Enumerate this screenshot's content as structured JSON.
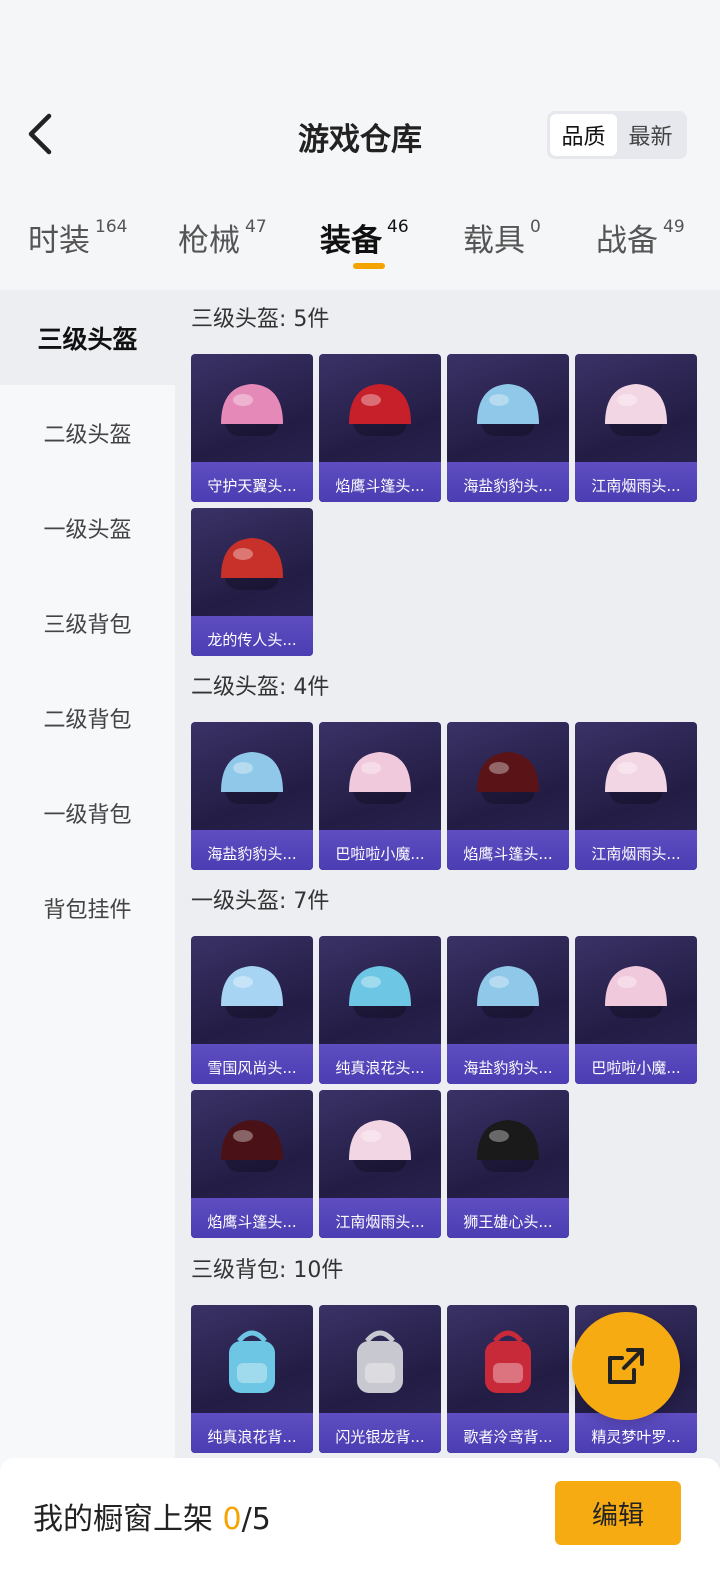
{
  "header": {
    "title": "游戏仓库",
    "sort_options": [
      "品质",
      "最新"
    ],
    "active_sort": "品质"
  },
  "tabs": [
    {
      "label": "时装",
      "count": "164"
    },
    {
      "label": "枪械",
      "count": "47"
    },
    {
      "label": "装备",
      "count": "46"
    },
    {
      "label": "载具",
      "count": "0"
    },
    {
      "label": "战备",
      "count": "49"
    }
  ],
  "active_tab": "装备",
  "sidebar": {
    "items": [
      "三级头盔",
      "二级头盔",
      "一级头盔",
      "三级背包",
      "二级背包",
      "一级背包",
      "背包挂件"
    ],
    "active": "三级头盔"
  },
  "sections": [
    {
      "title": "三级头盔: 5件",
      "items": [
        {
          "name": "守护天翼头...",
          "icon": "helmet-pink-icon",
          "color": "#e58ab8"
        },
        {
          "name": "焰鹰斗篷头...",
          "icon": "helmet-red-black-icon",
          "color": "#c8202a"
        },
        {
          "name": "海盐豹豹头...",
          "icon": "helmet-blue-icon",
          "color": "#8fc8e8"
        },
        {
          "name": "江南烟雨头...",
          "icon": "helmet-white-pink-icon",
          "color": "#f3d6e4"
        },
        {
          "name": "龙的传人头...",
          "icon": "helmet-red-gold-icon",
          "color": "#c8302a"
        }
      ]
    },
    {
      "title": "二级头盔: 4件",
      "items": [
        {
          "name": "海盐豹豹头...",
          "icon": "helmet-blue-icon",
          "color": "#8fc8e8"
        },
        {
          "name": "巴啦啦小魔...",
          "icon": "helmet-pink-bow-icon",
          "color": "#f1c9dc"
        },
        {
          "name": "焰鹰斗篷头...",
          "icon": "helmet-red-black-icon",
          "color": "#5a1418"
        },
        {
          "name": "江南烟雨头...",
          "icon": "helmet-white-pink-icon",
          "color": "#f3d6e4"
        }
      ]
    },
    {
      "title": "一级头盔: 7件",
      "items": [
        {
          "name": "雪国风尚头...",
          "icon": "helmet-snow-icon",
          "color": "#a8d4f4"
        },
        {
          "name": "纯真浪花头...",
          "icon": "helmet-wave-icon",
          "color": "#6cc6e4"
        },
        {
          "name": "海盐豹豹头...",
          "icon": "helmet-blue-icon",
          "color": "#8fc8e8"
        },
        {
          "name": "巴啦啦小魔...",
          "icon": "helmet-pink-bow-icon",
          "color": "#f1c9dc"
        },
        {
          "name": "焰鹰斗篷头...",
          "icon": "helmet-red-black-icon",
          "color": "#4a1216"
        },
        {
          "name": "江南烟雨头...",
          "icon": "helmet-white-pink-icon",
          "color": "#f3d6e4"
        },
        {
          "name": "狮王雄心头...",
          "icon": "helmet-black-gold-icon",
          "color": "#1a1a1a"
        }
      ]
    },
    {
      "title": "三级背包: 10件",
      "items": [
        {
          "name": "纯真浪花背...",
          "icon": "backpack-wave-icon",
          "color": "#6cc6e4"
        },
        {
          "name": "闪光银龙背...",
          "icon": "backpack-silver-dragon-icon",
          "color": "#c8c8d0"
        },
        {
          "name": "歌者泠鸢背...",
          "icon": "backpack-red-icon",
          "color": "#c82a3a"
        },
        {
          "name": "精灵梦叶罗...",
          "icon": "backpack-green-icon",
          "color": "#8ccf8a"
        }
      ]
    }
  ],
  "bottom_bar": {
    "showcase_label": "我的橱窗上架",
    "showcase_current": "0",
    "showcase_total": "/5",
    "edit_label": "编辑"
  },
  "colors": {
    "accent": "#f5a300",
    "card_bg": "#2b2454",
    "card_label_bg": "#4b3db2"
  }
}
